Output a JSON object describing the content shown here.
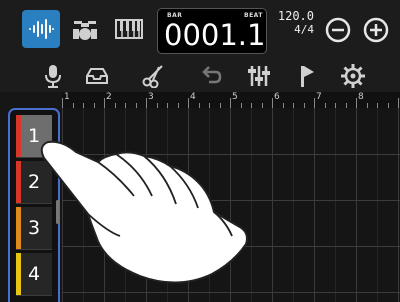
{
  "top": {
    "modes": [
      {
        "name": "waveform-mode-icon",
        "active": true
      },
      {
        "name": "drum-kit-mode-icon",
        "active": false
      },
      {
        "name": "piano-keys-mode-icon",
        "active": false
      }
    ],
    "counter": {
      "bar_label": "BAR",
      "beat_label": "BEAT",
      "value": "0001.1"
    },
    "tempo": {
      "bpm": "120.0",
      "signature": "4/4"
    }
  },
  "toolbar": {
    "tools": [
      "microphone-icon",
      "tray-icon",
      "scissors-icon",
      "undo-icon",
      "mixer-icon",
      "flag-icon",
      "settings-gear-icon"
    ]
  },
  "ruler": {
    "bars": [
      "1",
      "2",
      "3",
      "4",
      "5",
      "6",
      "7",
      "8"
    ]
  },
  "tracks": [
    {
      "number": "1",
      "color": "#d9362b",
      "selected": true
    },
    {
      "number": "2",
      "color": "#d9362b",
      "selected": false
    },
    {
      "number": "3",
      "color": "#e08a1e",
      "selected": false
    },
    {
      "number": "4",
      "color": "#e8c417",
      "selected": false
    }
  ]
}
